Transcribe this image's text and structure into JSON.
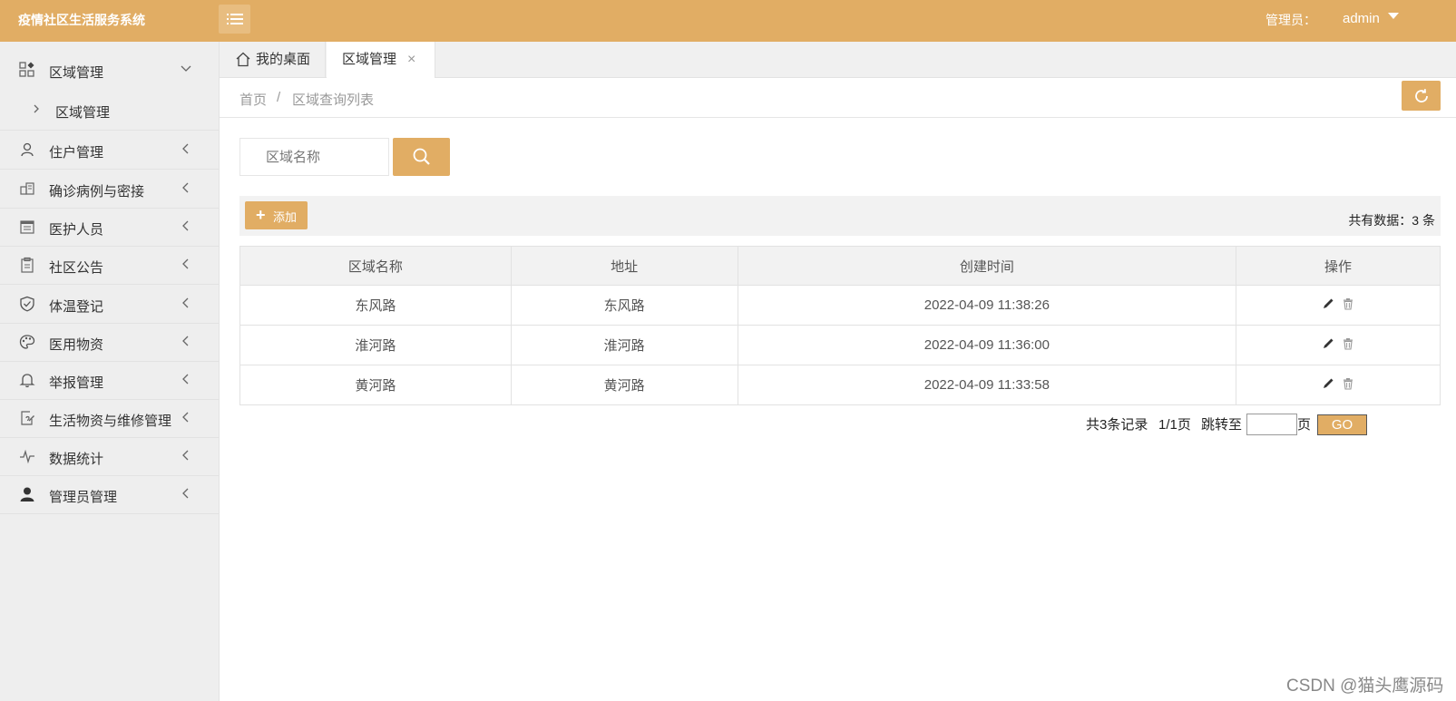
{
  "app": {
    "title": "疫情社区生活服务系统"
  },
  "header": {
    "admin_label": "管理员：",
    "admin_name": "admin"
  },
  "sidebar": {
    "items": [
      {
        "label": "区域管理",
        "icon": "grid-icon",
        "expanded": true,
        "children": [
          {
            "label": "区域管理"
          }
        ]
      },
      {
        "label": "住户管理",
        "icon": "user-icon"
      },
      {
        "label": "确诊病例与密接",
        "icon": "cases-icon"
      },
      {
        "label": "医护人员",
        "icon": "calendar-icon"
      },
      {
        "label": "社区公告",
        "icon": "clipboard-icon"
      },
      {
        "label": "体温登记",
        "icon": "shield-icon"
      },
      {
        "label": "医用物资",
        "icon": "palette-icon"
      },
      {
        "label": "举报管理",
        "icon": "bell-icon"
      },
      {
        "label": "生活物资与维修管理",
        "icon": "edit-doc-icon"
      },
      {
        "label": "数据统计",
        "icon": "pulse-icon"
      },
      {
        "label": "管理员管理",
        "icon": "person-icon"
      }
    ]
  },
  "tabs": [
    {
      "label": "我的桌面"
    },
    {
      "label": "区域管理",
      "close": "×"
    }
  ],
  "breadcrumb": {
    "home": "首页",
    "sep": "/",
    "current": "区域查询列表"
  },
  "search": {
    "placeholder": "区域名称",
    "value": ""
  },
  "toolbar": {
    "add_label": "添加",
    "add_plus": "+",
    "total_text": "共有数据：3 条"
  },
  "table": {
    "headers": [
      "区域名称",
      "地址",
      "创建时间",
      "操作"
    ],
    "rows": [
      {
        "name": "东风路",
        "address": "东风路",
        "created": "2022-04-09 11:38:26"
      },
      {
        "name": "淮河路",
        "address": "淮河路",
        "created": "2022-04-09 11:36:00"
      },
      {
        "name": "黄河路",
        "address": "黄河路",
        "created": "2022-04-09 11:33:58"
      }
    ]
  },
  "pager": {
    "records": "共3条记录",
    "pages": "1/1页",
    "jump_label": "跳转至",
    "page_unit": "页",
    "go_label": "GO",
    "jump_value": ""
  },
  "watermark": "CSDN @猫头鹰源码",
  "colors": {
    "accent": "#e1ad64",
    "sidebar_bg": "#eeeeee"
  }
}
